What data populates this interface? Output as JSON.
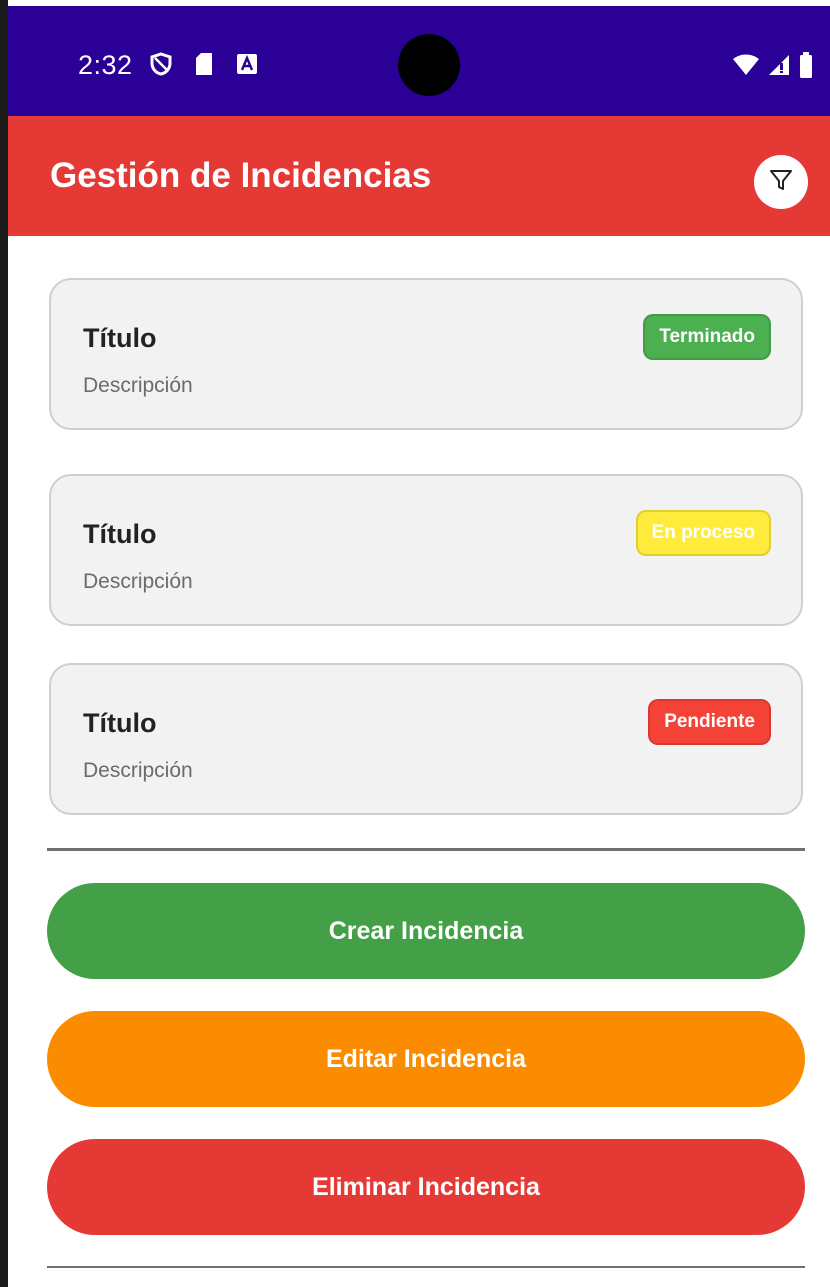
{
  "statusbar": {
    "time": "2:32",
    "left_icons": [
      "vpn-shield-icon",
      "sd-card-icon",
      "a-notification-icon"
    ],
    "right_icons": [
      "wifi-icon",
      "signal-icon",
      "battery-icon"
    ]
  },
  "appbar": {
    "title": "Gestión de Incidencias",
    "filter_icon": "filter-funnel-icon"
  },
  "incidents": [
    {
      "title": "Título",
      "description": "Descripción",
      "status": "Terminado",
      "status_color": "#4caf50",
      "status_text_color": "#ffffff"
    },
    {
      "title": "Título",
      "description": "Descripción",
      "status": "En proceso",
      "status_color": "#ffeb3b",
      "status_text_color": "#ffffff"
    },
    {
      "title": "Título",
      "description": "Descripción",
      "status": "Pendiente",
      "status_color": "#f44336",
      "status_text_color": "#ffffff"
    }
  ],
  "actions": {
    "create_label": "Crear Incidencia",
    "edit_label": "Editar Incidencia",
    "delete_label": "Eliminar Incidencia"
  },
  "colors": {
    "statusbar": "#2a0096",
    "appbar": "#e53935",
    "create": "#43a047",
    "edit": "#fb8c00",
    "delete": "#e53935"
  }
}
